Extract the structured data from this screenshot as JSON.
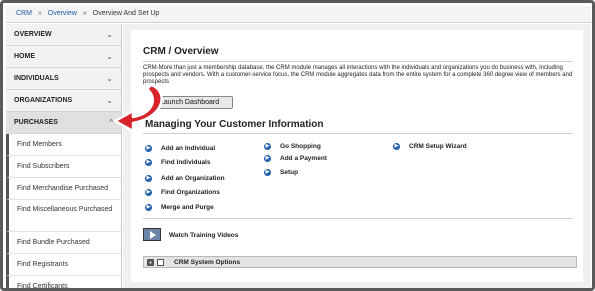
{
  "breadcrumb": {
    "items": [
      "CRM",
      "Overview",
      "Overview And Set Up"
    ],
    "separator": "»"
  },
  "sidebar": {
    "headers": [
      {
        "label": "OVERVIEW",
        "chevron": "⌄"
      },
      {
        "label": "HOME",
        "chevron": "⌄"
      },
      {
        "label": "INDIVIDUALS",
        "chevron": "⌄"
      },
      {
        "label": "ORGANIZATIONS",
        "chevron": "⌄"
      },
      {
        "label": "PURCHASES",
        "chevron": "^"
      }
    ],
    "items": [
      "Find Members",
      "Find Subscribers",
      "Find Merchandise Purchased",
      "Find Miscellaneous Purchased",
      "Find Bundle Purchased",
      "Find Registrants",
      "Find Certificants"
    ]
  },
  "main": {
    "title": "CRM / Overview",
    "description": "CRM-More than just a membership database, the CRM module manages all interactions with the individuals and organizations you do business with, including prospects and vendors. With a customer-service focus, the CRM module aggregates data from the entire system for a complete 360 degree view of members and prospects",
    "launch_button": "Launch Dashboard",
    "managing_title": "Managing Your Customer Information",
    "links_col1": [
      "Add an Individual",
      "Find Individuals",
      "Add an Organization",
      "Find Organizations",
      "Merge and Purge"
    ],
    "links_col2": [
      "Go Shopping",
      "Add a Payment",
      "Setup"
    ],
    "links_col3": [
      "CRM Setup Wizard"
    ],
    "training_label": "Watch Training Videos",
    "options_label": "CRM System Options"
  },
  "colors": {
    "accent_blue": "#1f5fa8",
    "callout_red": "#d9232a"
  },
  "icons": {
    "bullet": "circle-arrow-icon",
    "video": "video-icon",
    "callout": "curved-arrow-icon"
  }
}
